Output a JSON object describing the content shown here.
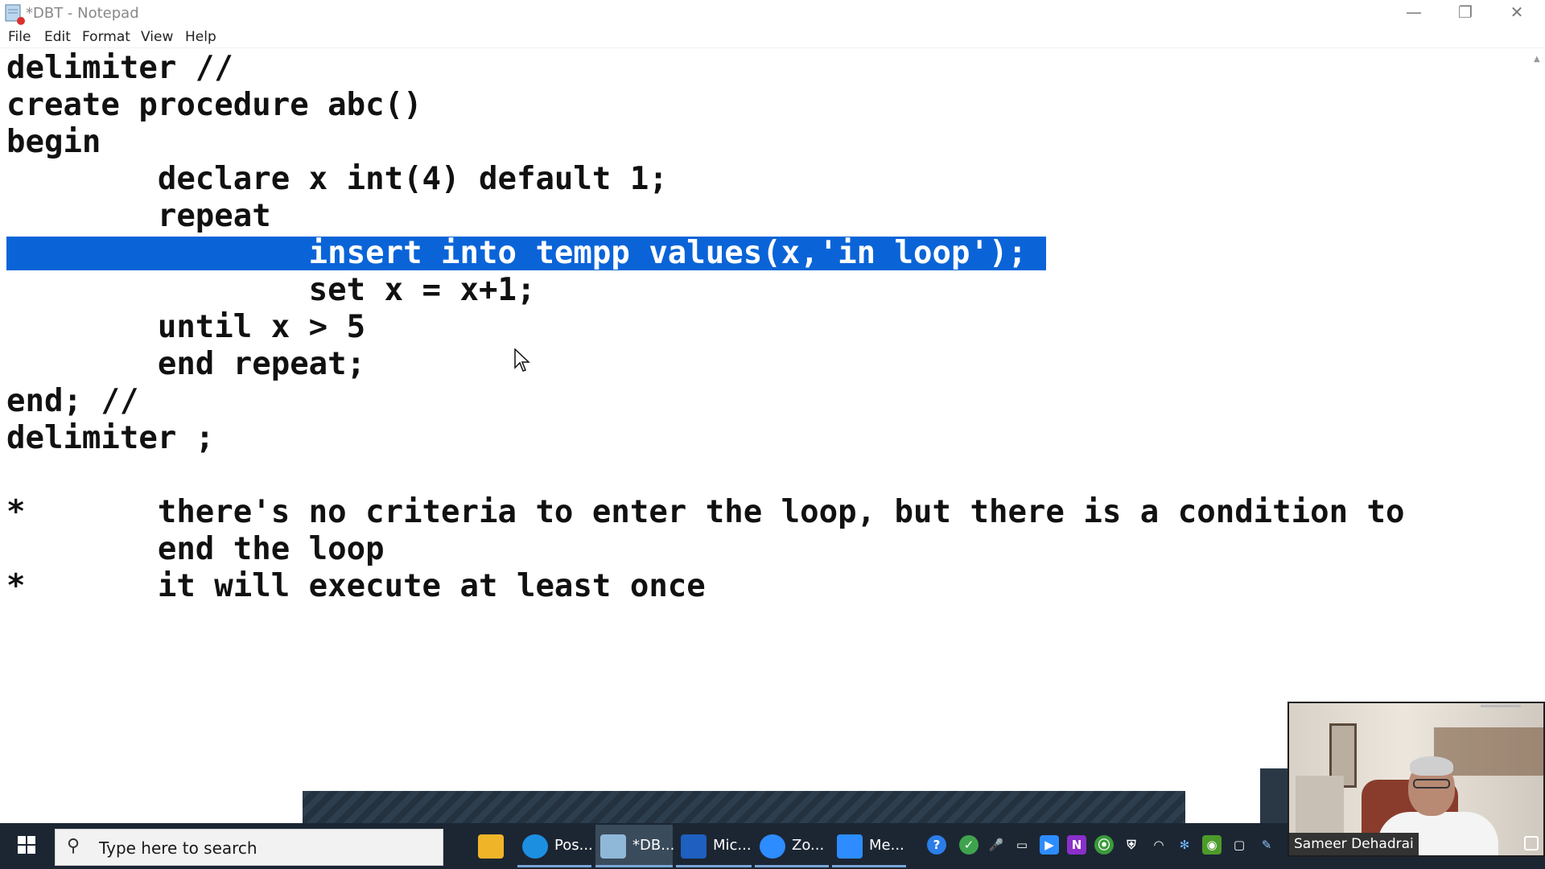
{
  "window": {
    "title": "*DBT - Notepad",
    "controls": {
      "minimize": "—",
      "maximize": "❐",
      "close": "✕"
    }
  },
  "menu": {
    "file": "File",
    "edit": "Edit",
    "format": "Format",
    "view": "View",
    "help": "Help"
  },
  "editor": {
    "lines": [
      "delimiter //",
      "create procedure abc()",
      "begin",
      "        declare x int(4) default 1;",
      "        repeat",
      "                insert into tempp values(x,'in loop');",
      "                set x = x+1;",
      "        until x > 5",
      "        end repeat;",
      "end; //",
      "delimiter ;",
      "",
      "*       there's no criteria to enter the loop, but there is a condition to",
      "        end the loop",
      "*       it will execute at least once"
    ],
    "selected_line_index": 5,
    "selection_color": "#0a64d8"
  },
  "taskbar": {
    "search_placeholder": "Type here to search",
    "items": [
      {
        "label": "",
        "icon": "file-explorer-icon",
        "color": "#f0b429"
      },
      {
        "label": "Pos...",
        "icon": "edge-icon",
        "color": "#1d8fe1"
      },
      {
        "label": "*DB...",
        "icon": "notepad-icon",
        "color": "#8fb8d8"
      },
      {
        "label": "Mic...",
        "icon": "whiteboard-icon",
        "color": "#1e5fbf"
      },
      {
        "label": "Zo...",
        "icon": "zoom-icon",
        "color": "#2d8cff"
      },
      {
        "label": "Me...",
        "icon": "zoom-meeting-icon",
        "color": "#2d8cff"
      }
    ],
    "tray": [
      {
        "icon": "help-icon",
        "text": "?",
        "color": "#2b7de9"
      },
      {
        "icon": "check-icon",
        "text": "✓",
        "color": "#3fa34d"
      },
      {
        "icon": "microphone-icon",
        "text": "🎤",
        "color": "#1c2633"
      },
      {
        "icon": "battery-icon",
        "text": "▭",
        "color": "#1c2633"
      },
      {
        "icon": "zoom-tray-icon",
        "text": "▶",
        "color": "#2d8cff"
      },
      {
        "icon": "onenote-icon",
        "text": "N",
        "color": "#8b2fc9"
      },
      {
        "icon": "green-app-icon",
        "text": "⦿",
        "color": "#3a9a3a"
      },
      {
        "icon": "shield-icon",
        "text": "⛨",
        "color": "#1c2633"
      },
      {
        "icon": "wifi-icon",
        "text": "◠",
        "color": "#1c2633"
      },
      {
        "icon": "snowflake-icon",
        "text": "✻",
        "color": "#2e7bd6"
      },
      {
        "icon": "nvidia-icon",
        "text": "◉",
        "color": "#4c9a2a"
      },
      {
        "icon": "display-icon",
        "text": "▢",
        "color": "#1c2633"
      },
      {
        "icon": "pen-icon",
        "text": "✎",
        "color": "#4a90d9"
      }
    ]
  },
  "webcam": {
    "participant_name": "Sameer Dehadrai"
  }
}
